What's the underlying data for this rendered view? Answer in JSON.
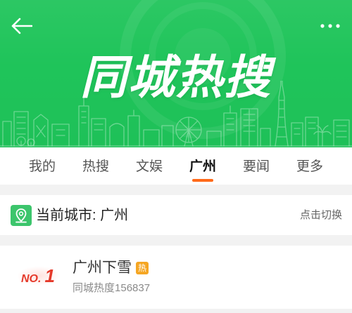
{
  "header": {
    "title": "同城热搜",
    "back_icon": "arrow-left-icon",
    "more_icon": "more-dots-icon",
    "illustration": "city-skyline-illustration"
  },
  "tabs": [
    {
      "label": "我的",
      "active": false
    },
    {
      "label": "热搜",
      "active": false
    },
    {
      "label": "文娱",
      "active": false
    },
    {
      "label": "广州",
      "active": true
    },
    {
      "label": "要闻",
      "active": false
    },
    {
      "label": "更多",
      "active": false
    }
  ],
  "city_bar": {
    "icon": "location-pin-icon",
    "label": "当前城市: 广州",
    "switch_label": "点击切换"
  },
  "hot_list": [
    {
      "rank_prefix": "NO.",
      "rank_number": "1",
      "title": "广州下雪",
      "badge": "热",
      "heat_label": "同城热度",
      "heat_value": "156837"
    }
  ],
  "colors": {
    "brand_green": "#1fc45a",
    "tab_indicator": "#ff6a1a",
    "hot_badge": "#f5a623",
    "rank_red": "#e5392a",
    "city_icon_green": "#3cc56c"
  }
}
